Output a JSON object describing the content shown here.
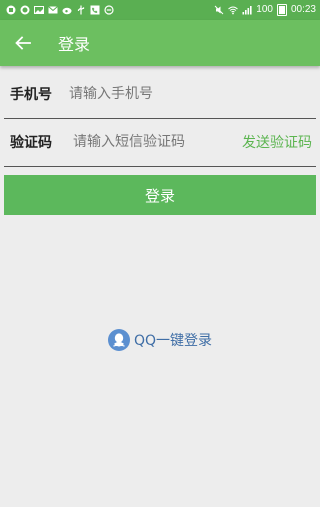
{
  "status_bar": {
    "battery_level": "100",
    "time": "00:23"
  },
  "toolbar": {
    "title": "登录",
    "back_icon": "arrow-left-icon"
  },
  "form": {
    "phone_label": "手机号",
    "phone_placeholder": "请输入手机号",
    "phone_value": "",
    "code_label": "验证码",
    "code_placeholder": "请输入短信验证码",
    "code_value": "",
    "send_code_label": "发送验证码"
  },
  "login_button_label": "登录",
  "qq_login": {
    "icon": "qq-penguin-icon",
    "label": "QQ一键登录"
  },
  "colors": {
    "status_bar": "#5aaf52",
    "toolbar": "#6cbf60",
    "accent": "#5cb550",
    "qq_text": "#3f6ea6",
    "background": "#ededed"
  }
}
